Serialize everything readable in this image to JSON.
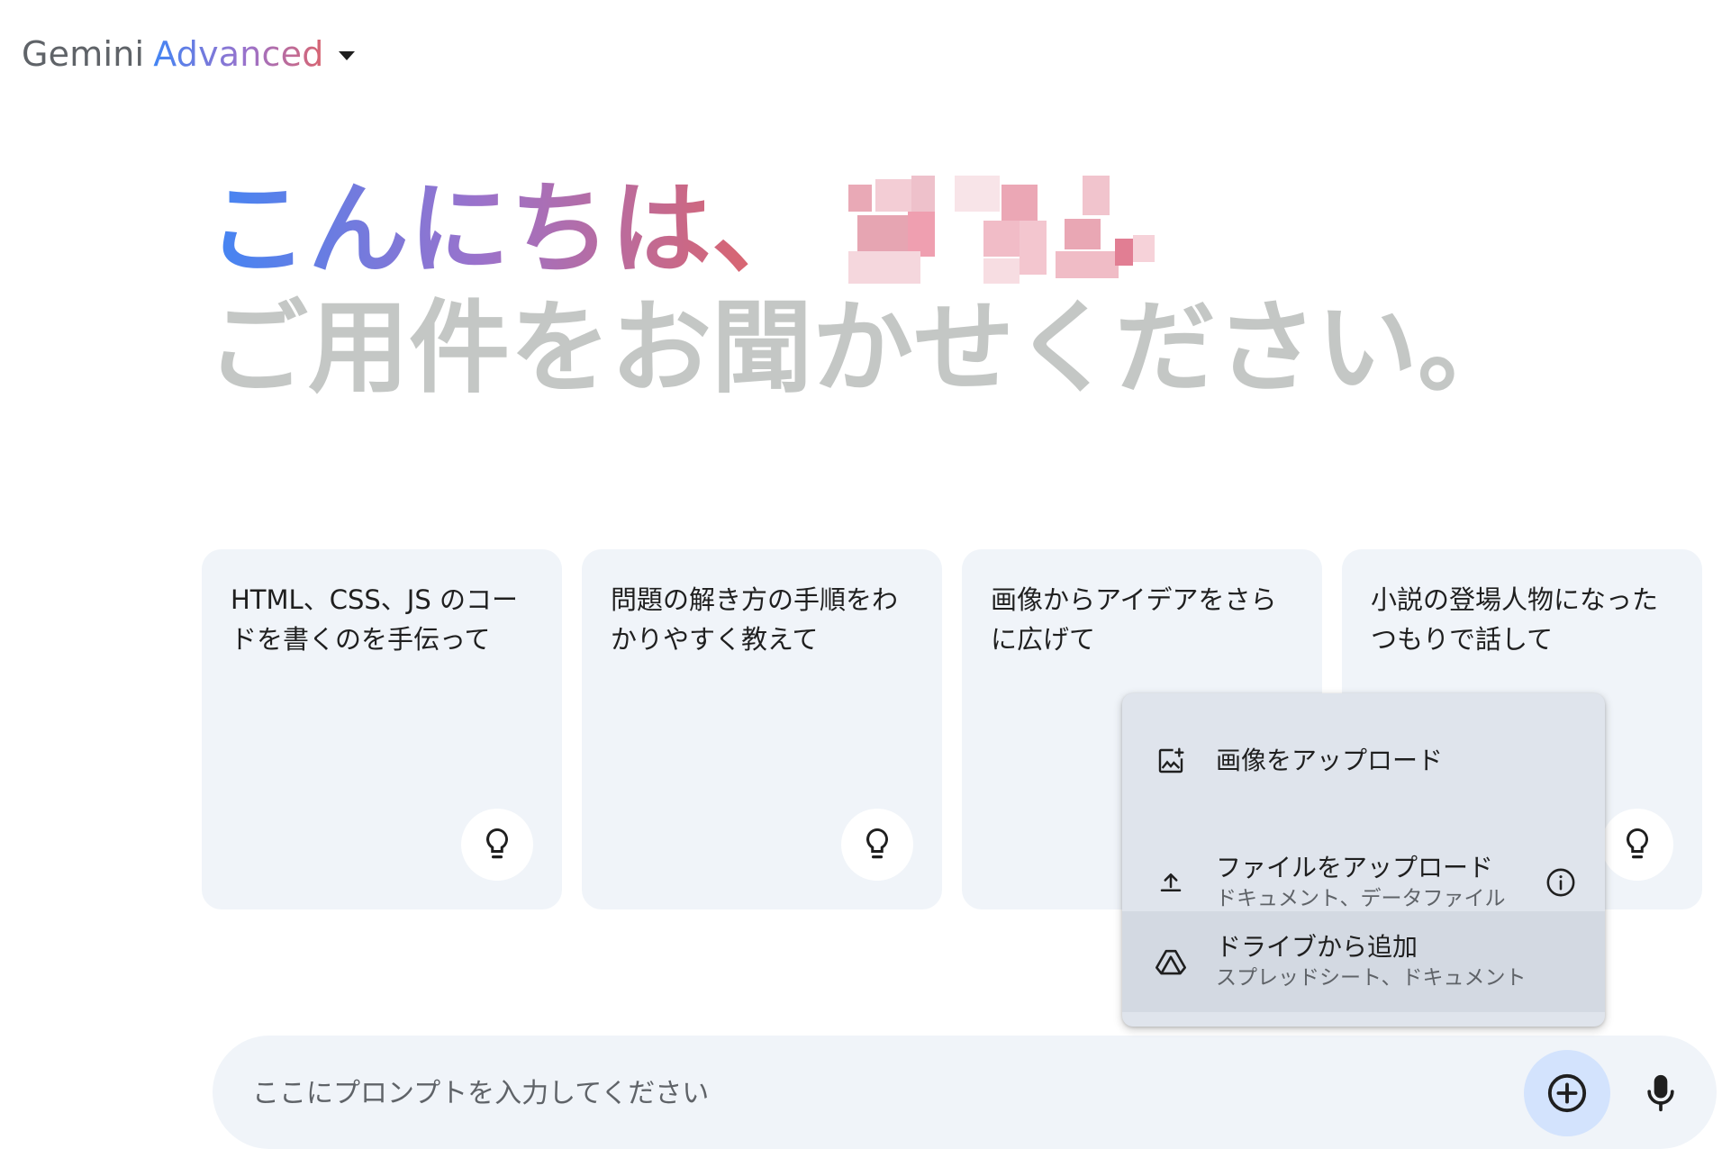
{
  "header": {
    "brand": "Gemini",
    "tier": "Advanced"
  },
  "greeting": {
    "hello": "こんにちは、",
    "prompt": "ご用件をお聞かせください。"
  },
  "cards": [
    {
      "text": "HTML、CSS、JS のコードを書くのを手伝って",
      "icon": "lightbulb-icon"
    },
    {
      "text": "問題の解き方の手順をわかりやすく教えて",
      "icon": "lightbulb-icon"
    },
    {
      "text": "画像からアイデアをさらに広げて",
      "icon": "lightbulb-icon"
    },
    {
      "text": "小説の登場人物になったつもりで話して",
      "icon": "lightbulb-icon"
    }
  ],
  "upload_menu": {
    "image": {
      "title": "画像をアップロード",
      "icon": "image-upload-icon"
    },
    "file": {
      "title": "ファイルをアップロード",
      "subtitle": "ドキュメント、データファイル",
      "icon": "upload-icon"
    },
    "drive": {
      "title": "ドライブから追加",
      "subtitle": "スプレッドシート、ドキュメント",
      "icon": "drive-icon"
    }
  },
  "prompt": {
    "placeholder": "ここにプロンプトを入力してください"
  },
  "colors": {
    "card_bg": "#f0f4f9",
    "menu_bg": "#dfe4ec",
    "menu_hover": "#d3d9e2",
    "add_button_bg": "#d3e3fd",
    "muted_text": "#c4c7c5"
  }
}
